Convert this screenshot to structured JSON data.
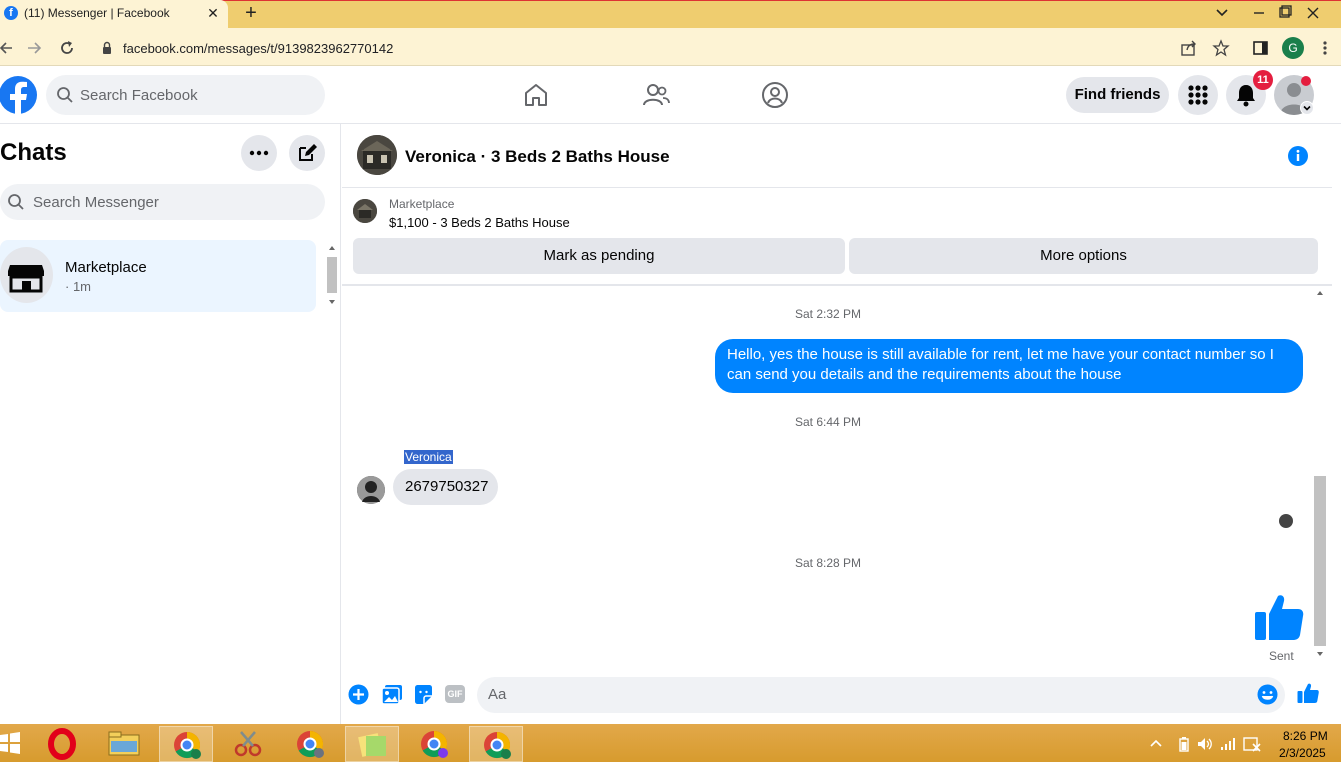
{
  "browser": {
    "tab_title": "(11) Messenger | Facebook",
    "tab_close": "✕",
    "new_tab": "+",
    "url": "facebook.com/messages/t/9139823962770142",
    "profile_initial": "G"
  },
  "facebook": {
    "search_placeholder": "Search Facebook",
    "find_friends_label": "Find friends",
    "notification_count": "11"
  },
  "sidebar": {
    "title": "Chats",
    "search_placeholder": "Search Messenger",
    "chats": [
      {
        "name": "Marketplace",
        "meta": "· 1m"
      }
    ]
  },
  "conversation": {
    "title": "Veronica · 3 Beds 2 Baths House",
    "listing": {
      "source": "Marketplace",
      "title": "$1,100 - 3 Beds 2 Baths House",
      "mark_pending_label": "Mark as pending",
      "more_options_label": "More options"
    },
    "messages": {
      "ts1": "Sat 2:32 PM",
      "out1": "Hello, yes the house is still available for rent, let me have your contact number so I can send you details and the requirements about the house",
      "ts2": "Sat 6:44 PM",
      "sender_name": "Veronica",
      "in1": "2679750327",
      "ts3": "Sat 8:28 PM",
      "status": "Sent"
    },
    "composer_placeholder": "Aa",
    "gif_label": "GIF"
  },
  "taskbar": {
    "time": "8:26 PM",
    "date": "2/3/2025"
  },
  "colors": {
    "messenger_blue": "#0084ff",
    "facebook_blue": "#1877f2",
    "notification_red": "#e41e3f",
    "chrome_frame": "#efcd6f",
    "taskbar": "#d79b2e"
  }
}
